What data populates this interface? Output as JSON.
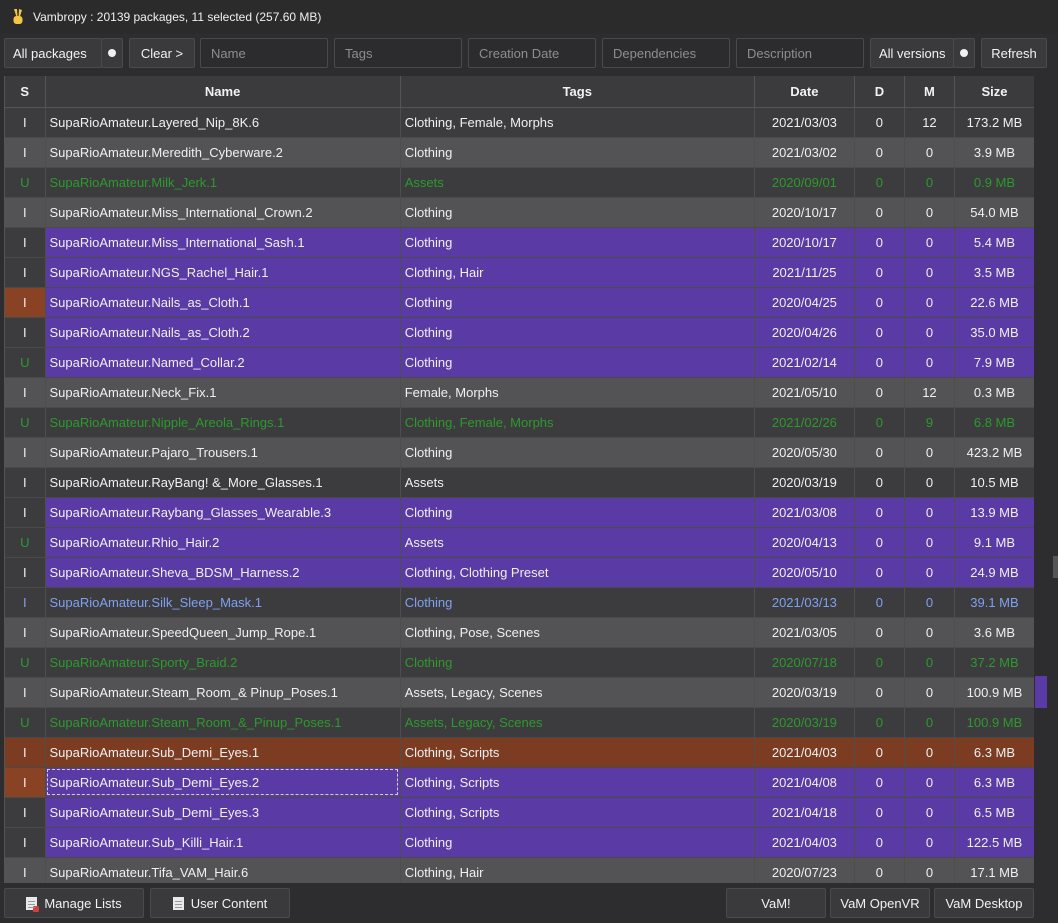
{
  "window": {
    "title": "Vambropy : 20139 packages, 11 selected (257.60 MB)",
    "icon": "victory-hand-icon"
  },
  "toolbar": {
    "filter_value": "All packages",
    "clear_label": "Clear >",
    "name_placeholder": "Name",
    "tags_placeholder": "Tags",
    "date_placeholder": "Creation Date",
    "deps_placeholder": "Dependencies",
    "desc_placeholder": "Description",
    "versions_value": "All versions",
    "refresh_label": "Refresh"
  },
  "table": {
    "columns": [
      "S",
      "Name",
      "Tags",
      "Date",
      "D",
      "M",
      "Size"
    ],
    "rows": [
      {
        "s": "I",
        "name": "SupaRioAmateur.Layered_Nip_8K.6",
        "tags": "Clothing, Female, Morphs",
        "date": "2021/03/03",
        "d": "0",
        "m": "12",
        "size": "173.2 MB",
        "style": "bg-a txt-white"
      },
      {
        "s": "I",
        "name": "SupaRioAmateur.Meredith_Cyberware.2",
        "tags": "Clothing",
        "date": "2021/03/02",
        "d": "0",
        "m": "0",
        "size": "3.9 MB",
        "style": "bg-b txt-white"
      },
      {
        "s": "U",
        "name": "SupaRioAmateur.Milk_Jerk.1",
        "tags": "Assets",
        "date": "2020/09/01",
        "d": "0",
        "m": "0",
        "size": "0.9 MB",
        "style": "bg-a txt-green"
      },
      {
        "s": "I",
        "name": "SupaRioAmateur.Miss_International_Crown.2",
        "tags": "Clothing",
        "date": "2020/10/17",
        "d": "0",
        "m": "0",
        "size": "54.0 MB",
        "style": "bg-b txt-white"
      },
      {
        "s": "I",
        "name": "SupaRioAmateur.Miss_International_Sash.1",
        "tags": "Clothing",
        "date": "2020/10/17",
        "d": "0",
        "m": "0",
        "size": "5.4 MB",
        "style": "bg-p txt-white",
        "s_style": "s-dark"
      },
      {
        "s": "I",
        "name": "SupaRioAmateur.NGS_Rachel_Hair.1",
        "tags": "Clothing, Hair",
        "date": "2021/11/25",
        "d": "0",
        "m": "0",
        "size": "3.5 MB",
        "style": "bg-p txt-white",
        "s_style": "s-dark"
      },
      {
        "s": "I",
        "name": "SupaRioAmateur.Nails_as_Cloth.1",
        "tags": "Clothing",
        "date": "2020/04/25",
        "d": "0",
        "m": "0",
        "size": "22.6 MB",
        "style": "bg-p txt-white",
        "s_style": "s-orange"
      },
      {
        "s": "I",
        "name": "SupaRioAmateur.Nails_as_Cloth.2",
        "tags": "Clothing",
        "date": "2020/04/26",
        "d": "0",
        "m": "0",
        "size": "35.0 MB",
        "style": "bg-p txt-white",
        "s_style": "s-dark"
      },
      {
        "s": "U",
        "name": "SupaRioAmateur.Named_Collar.2",
        "tags": "Clothing",
        "date": "2021/02/14",
        "d": "0",
        "m": "0",
        "size": "7.9 MB",
        "style": "bg-p txt-white",
        "s_style": "s-dark-u"
      },
      {
        "s": "I",
        "name": "SupaRioAmateur.Neck_Fix.1",
        "tags": "Female, Morphs",
        "date": "2021/05/10",
        "d": "0",
        "m": "12",
        "size": "0.3 MB",
        "style": "bg-b txt-white"
      },
      {
        "s": "U",
        "name": "SupaRioAmateur.Nipple_Areola_Rings.1",
        "tags": "Clothing, Female, Morphs",
        "date": "2021/02/26",
        "d": "0",
        "m": "9",
        "size": "6.8 MB",
        "style": "bg-a txt-green"
      },
      {
        "s": "I",
        "name": "SupaRioAmateur.Pajaro_Trousers.1",
        "tags": "Clothing",
        "date": "2020/05/30",
        "d": "0",
        "m": "0",
        "size": "423.2 MB",
        "style": "bg-b txt-white"
      },
      {
        "s": "I",
        "name": "SupaRioAmateur.RayBang! &_More_Glasses.1",
        "tags": "Assets",
        "date": "2020/03/19",
        "d": "0",
        "m": "0",
        "size": "10.5 MB",
        "style": "bg-a txt-white"
      },
      {
        "s": "I",
        "name": "SupaRioAmateur.Raybang_Glasses_Wearable.3",
        "tags": "Clothing",
        "date": "2021/03/08",
        "d": "0",
        "m": "0",
        "size": "13.9 MB",
        "style": "bg-p txt-white",
        "s_style": "s-dark"
      },
      {
        "s": "U",
        "name": "SupaRioAmateur.Rhio_Hair.2",
        "tags": "Assets",
        "date": "2020/04/13",
        "d": "0",
        "m": "0",
        "size": "9.1 MB",
        "style": "bg-p txt-white",
        "s_style": "s-dark-u"
      },
      {
        "s": "I",
        "name": "SupaRioAmateur.Sheva_BDSM_Harness.2",
        "tags": "Clothing, Clothing Preset",
        "date": "2020/05/10",
        "d": "0",
        "m": "0",
        "size": "24.9 MB",
        "style": "bg-p txt-white",
        "s_style": "s-dark"
      },
      {
        "s": "I",
        "name": "SupaRioAmateur.Silk_Sleep_Mask.1",
        "tags": "Clothing",
        "date": "2021/03/13",
        "d": "0",
        "m": "0",
        "size": "39.1 MB",
        "style": "bg-a txt-blue"
      },
      {
        "s": "I",
        "name": "SupaRioAmateur.SpeedQueen_Jump_Rope.1",
        "tags": "Clothing, Pose, Scenes",
        "date": "2021/03/05",
        "d": "0",
        "m": "0",
        "size": "3.6 MB",
        "style": "bg-b txt-white"
      },
      {
        "s": "U",
        "name": "SupaRioAmateur.Sporty_Braid.2",
        "tags": "Clothing",
        "date": "2020/07/18",
        "d": "0",
        "m": "0",
        "size": "37.2 MB",
        "style": "bg-a txt-green"
      },
      {
        "s": "I",
        "name": "SupaRioAmateur.Steam_Room_& Pinup_Poses.1",
        "tags": "Assets, Legacy, Scenes",
        "date": "2020/03/19",
        "d": "0",
        "m": "0",
        "size": "100.9 MB",
        "style": "bg-b txt-white"
      },
      {
        "s": "U",
        "name": "SupaRioAmateur.Steam_Room_&_Pinup_Poses.1",
        "tags": "Assets, Legacy, Scenes",
        "date": "2020/03/19",
        "d": "0",
        "m": "0",
        "size": "100.9 MB",
        "style": "bg-a txt-green"
      },
      {
        "s": "I",
        "name": "SupaRioAmateur.Sub_Demi_Eyes.1",
        "tags": "Clothing, Scripts",
        "date": "2021/04/03",
        "d": "0",
        "m": "0",
        "size": "6.3 MB",
        "style": "bg-o txt-white"
      },
      {
        "s": "I",
        "name": "SupaRioAmateur.Sub_Demi_Eyes.2",
        "tags": "Clothing, Scripts",
        "date": "2021/04/08",
        "d": "0",
        "m": "0",
        "size": "6.3 MB",
        "style": "bg-p txt-white",
        "s_style": "s-orange",
        "focus": true
      },
      {
        "s": "I",
        "name": "SupaRioAmateur.Sub_Demi_Eyes.3",
        "tags": "Clothing, Scripts",
        "date": "2021/04/18",
        "d": "0",
        "m": "0",
        "size": "6.5 MB",
        "style": "bg-p txt-white",
        "s_style": "s-dark"
      },
      {
        "s": "I",
        "name": "SupaRioAmateur.Sub_Killi_Hair.1",
        "tags": "Clothing",
        "date": "2021/04/03",
        "d": "0",
        "m": "0",
        "size": "122.5 MB",
        "style": "bg-p txt-white",
        "s_style": "s-dark"
      },
      {
        "s": "I",
        "name": "SupaRioAmateur.Tifa_VAM_Hair.6",
        "tags": "Clothing, Hair",
        "date": "2020/07/23",
        "d": "0",
        "m": "0",
        "size": "17.1 MB",
        "style": "bg-b txt-white"
      }
    ]
  },
  "bottom": {
    "manage_lists": "Manage Lists",
    "user_content": "User Content",
    "vam": "VaM!",
    "vam_openvr": "VaM OpenVR",
    "vam_desktop": "VaM Desktop"
  }
}
